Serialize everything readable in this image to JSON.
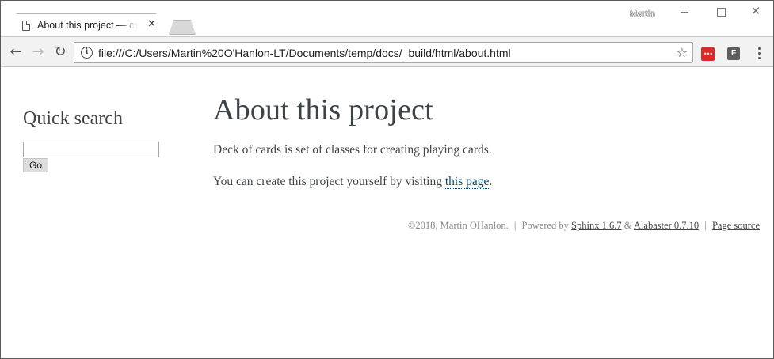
{
  "browser": {
    "tab_title": "About this project — card",
    "tab_close": "✕",
    "profile_name": "Martin",
    "url": "file:///C:/Users/Martin%20O'Hanlon-LT/Documents/temp/docs/_build/html/about.html",
    "icons": {
      "back": "←",
      "forward": "→",
      "reload": "↻",
      "star": "☆",
      "info": "i",
      "extension_f": "F",
      "extension_lastpass": "•••",
      "close": "✕"
    }
  },
  "sidebar": {
    "heading": "Quick search",
    "search_value": "",
    "go_label": "Go"
  },
  "main": {
    "title": "About this project",
    "paragraph_1": "Deck of cards is set of classes for creating playing cards.",
    "paragraph_2_prefix": "You can create this project yourself by visiting ",
    "paragraph_2_link": "this page",
    "paragraph_2_suffix": "."
  },
  "footer": {
    "copyright": "©2018, Martin OHanlon.",
    "separator": "|",
    "powered_by": "Powered by",
    "sphinx_link": "Sphinx 1.6.7",
    "ampersand": "&",
    "alabaster_link": "Alabaster 0.7.10",
    "page_source_link": "Page source"
  }
}
